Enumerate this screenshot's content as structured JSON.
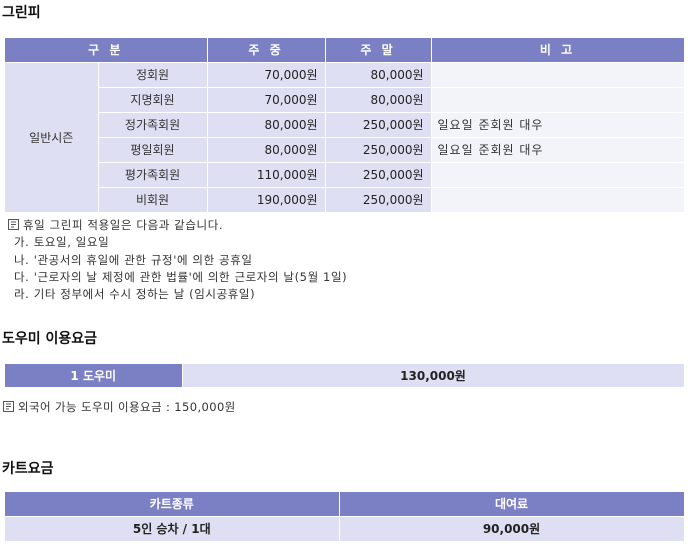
{
  "greenfee": {
    "title": "그린피",
    "headers": [
      "구 분",
      "주 중",
      "주 말",
      "비 고"
    ],
    "group_label": "일반시즌",
    "rows": [
      {
        "type": "정회원",
        "weekday": "70,000원",
        "weekend": "80,000원",
        "note": ""
      },
      {
        "type": "지명회원",
        "weekday": "70,000원",
        "weekend": "80,000원",
        "note": ""
      },
      {
        "type": "정가족회원",
        "weekday": "80,000원",
        "weekend": "250,000원",
        "note": "일요일 준회원 대우"
      },
      {
        "type": "평일회원",
        "weekday": "80,000원",
        "weekend": "250,000원",
        "note": "일요일 준회원 대우"
      },
      {
        "type": "평가족회원",
        "weekday": "110,000원",
        "weekend": "250,000원",
        "note": ""
      },
      {
        "type": "비회원",
        "weekday": "190,000원",
        "weekend": "250,000원",
        "note": ""
      }
    ],
    "notes_intro": "휴일 그린피 적용일은 다음과 같습니다.",
    "notes": [
      "가. 토요일, 일요일",
      "나. '관공서의 휴일에 관한 규정'에 의한 공휴일",
      "다. '근로자의 날 제정에 관한 법률'에 의한 근로자의 날(5월 1일)",
      "라. 기타 정부에서 수시 정하는 날 (임시공휴일)"
    ]
  },
  "caddie": {
    "title": "도우미 이용요금",
    "label": "1 도우미",
    "value": "130,000원",
    "note": "외국어 가능 도우미 이용요금 : 150,000원"
  },
  "cart": {
    "title": "카트요금",
    "headers": [
      "카트종류",
      "대여료"
    ],
    "row": {
      "type": "5인 승차 / 1대",
      "fee": "90,000원"
    }
  },
  "colors": {
    "header_purple": "#7b7fc4",
    "cell_lavender": "#dedff2",
    "note_cell": "#f3f3fa"
  },
  "icons": {
    "note": "memo-pointer-icon"
  }
}
